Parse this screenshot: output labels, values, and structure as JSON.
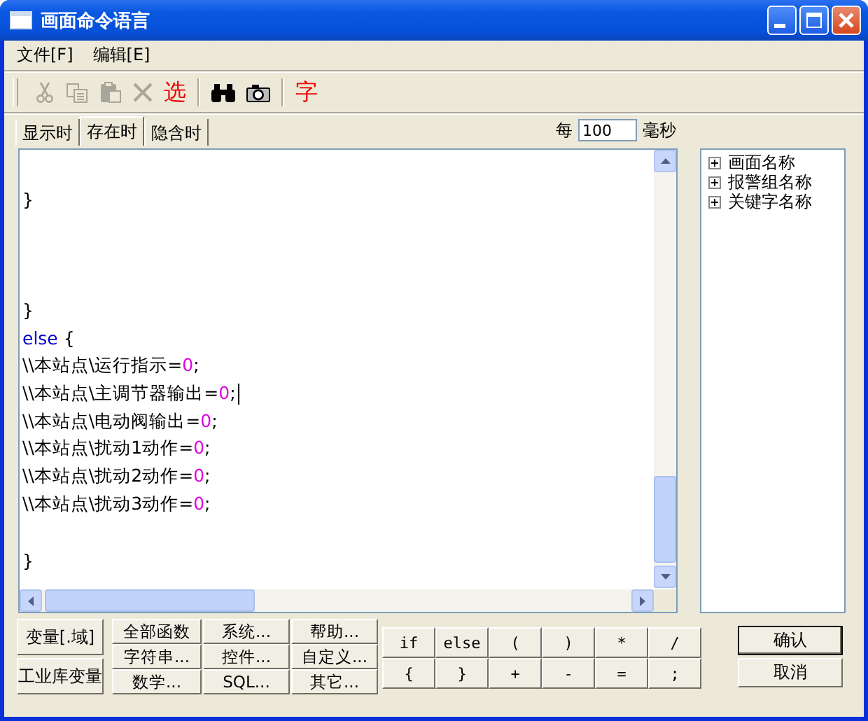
{
  "window": {
    "title": "画面命令语言"
  },
  "menu": [
    "文件[F]",
    "编辑[E]"
  ],
  "toolbar": [
    {
      "kind": "cut",
      "disabled": true
    },
    {
      "kind": "copy",
      "disabled": true
    },
    {
      "kind": "paste",
      "disabled": true
    },
    {
      "kind": "delete",
      "disabled": true
    },
    {
      "kind": "glyph",
      "label": "选",
      "disabled": false
    },
    {
      "kind": "sep"
    },
    {
      "kind": "find",
      "disabled": false
    },
    {
      "kind": "camera",
      "disabled": false
    },
    {
      "kind": "sep"
    },
    {
      "kind": "glyph",
      "label": "字",
      "disabled": false
    }
  ],
  "tabs": [
    {
      "label": "显示时",
      "selected": false
    },
    {
      "label": "存在时",
      "selected": true
    },
    {
      "label": "隐含时",
      "selected": false
    }
  ],
  "interval": {
    "prefix": "每",
    "value": "100",
    "unit": "毫秒"
  },
  "code_lines": [
    {
      "kind": "blank"
    },
    {
      "kind": "code",
      "tokens": [
        {
          "kind": "text",
          "text": "}"
        }
      ]
    },
    {
      "kind": "blank"
    },
    {
      "kind": "blank"
    },
    {
      "kind": "blank"
    },
    {
      "kind": "code",
      "tokens": [
        {
          "kind": "text",
          "text": "}"
        }
      ]
    },
    {
      "kind": "code",
      "tokens": [
        {
          "kind": "keyword",
          "text": "else"
        },
        {
          "kind": "text",
          "text": " {"
        }
      ]
    },
    {
      "kind": "code",
      "tokens": [
        {
          "kind": "text",
          "text": "\\\\本站点\\运行指示="
        },
        {
          "kind": "number",
          "text": "0"
        },
        {
          "kind": "text",
          "text": ";"
        }
      ]
    },
    {
      "kind": "code",
      "cursor": true,
      "tokens": [
        {
          "kind": "text",
          "text": "\\\\本站点\\主调节器输出="
        },
        {
          "kind": "number",
          "text": "0"
        },
        {
          "kind": "text",
          "text": ";"
        }
      ]
    },
    {
      "kind": "code",
      "tokens": [
        {
          "kind": "text",
          "text": "\\\\本站点\\电动阀输出="
        },
        {
          "kind": "number",
          "text": "0"
        },
        {
          "kind": "text",
          "text": ";"
        }
      ]
    },
    {
      "kind": "code",
      "tokens": [
        {
          "kind": "text",
          "text": "\\\\本站点\\扰动1动作="
        },
        {
          "kind": "number",
          "text": "0"
        },
        {
          "kind": "text",
          "text": ";"
        }
      ]
    },
    {
      "kind": "code",
      "tokens": [
        {
          "kind": "text",
          "text": "\\\\本站点\\扰动2动作="
        },
        {
          "kind": "number",
          "text": "0"
        },
        {
          "kind": "text",
          "text": ";"
        }
      ]
    },
    {
      "kind": "code",
      "tokens": [
        {
          "kind": "text",
          "text": "\\\\本站点\\扰动3动作="
        },
        {
          "kind": "number",
          "text": "0"
        },
        {
          "kind": "text",
          "text": ";"
        }
      ]
    },
    {
      "kind": "blank"
    },
    {
      "kind": "code",
      "tokens": [
        {
          "kind": "text",
          "text": "}"
        }
      ]
    }
  ],
  "tree": [
    {
      "label": "画面名称",
      "expanded": false
    },
    {
      "label": "报警组名称",
      "expanded": false
    },
    {
      "label": "关键字名称",
      "expanded": false
    }
  ],
  "variable_buttons": [
    "变量[.域]",
    "工业库变量"
  ],
  "function_buttons": [
    "全部函数",
    "系统...",
    "帮助...",
    "字符串...",
    "控件...",
    "自定义...",
    "数学...",
    "SQL...",
    "其它..."
  ],
  "operator_buttons": [
    "if",
    "else",
    "(",
    ")",
    "*",
    "/",
    "{",
    "}",
    "+",
    "-",
    "=",
    ";"
  ],
  "dialog_buttons": [
    {
      "label": "确认",
      "default": true
    },
    {
      "label": "取消",
      "default": false
    }
  ]
}
